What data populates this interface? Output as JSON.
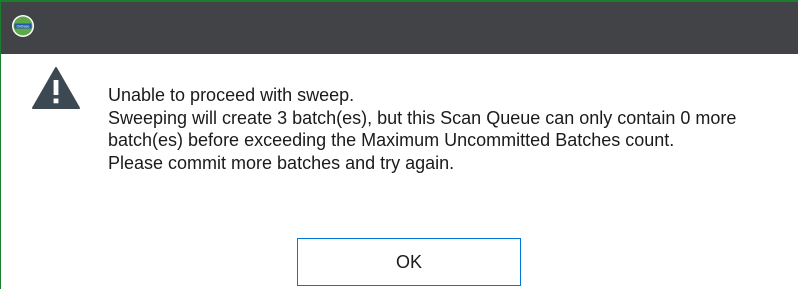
{
  "dialog": {
    "title_logo_text": "OnBase",
    "icon": "warning-triangle-icon",
    "message_lines": [
      "Unable to proceed with sweep.",
      "Sweeping will create 3 batch(es), but this Scan Queue can only contain 0 more batch(es) before exceeding the Maximum Uncommitted Batches count.",
      "Please commit more batches and try again."
    ],
    "ok_label": "OK"
  },
  "colors": {
    "titlebar": "#414346",
    "window_border": "#1a7f2c",
    "button_border": "#0078d7",
    "icon": "#3c4852"
  }
}
